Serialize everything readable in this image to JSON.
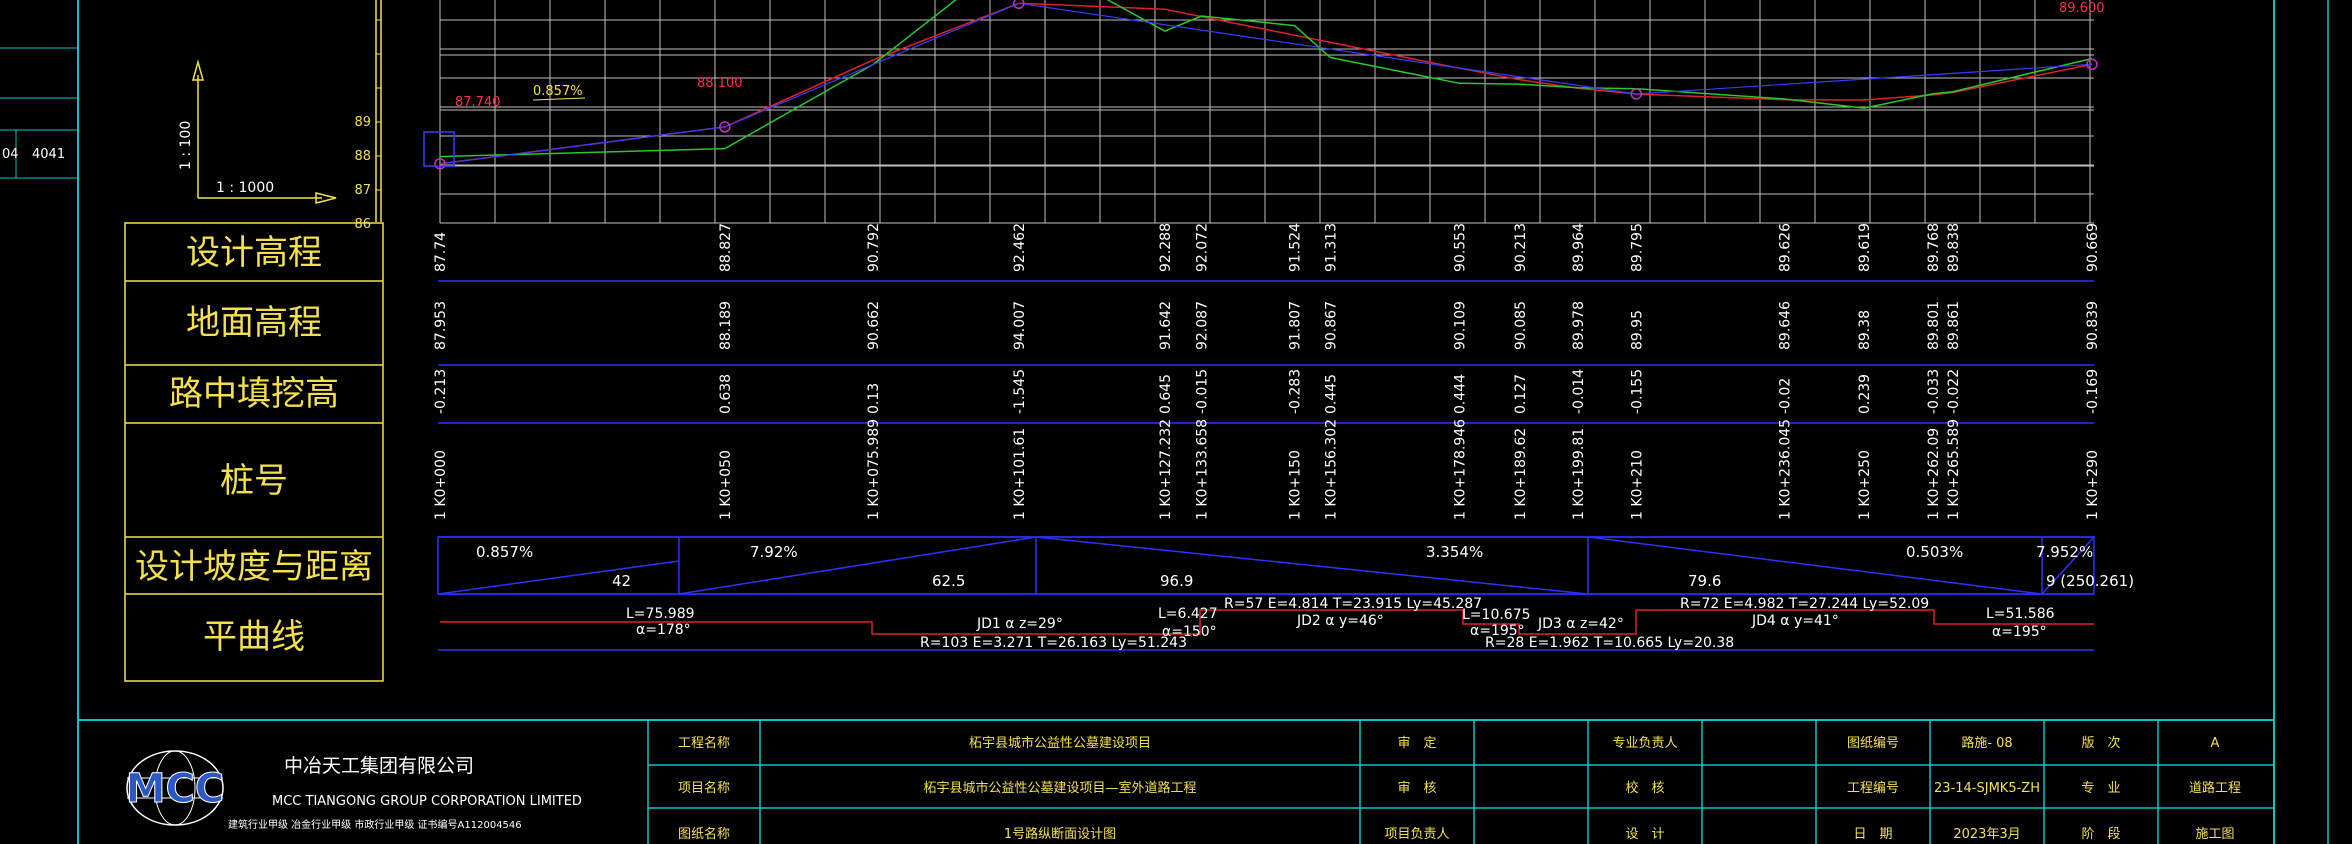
{
  "colors": {
    "background": "#000000",
    "frame": "#00c8c8",
    "label_text": "#f4e04d",
    "value_text": "#ffffff",
    "table_line": "#2f2fff",
    "design_line": "#e0202a",
    "ground_line": "#28c828",
    "blue_line": "#3a3aff",
    "annotation_red": "#ff2a55",
    "marker": "#c030c0",
    "grid": "#bfbfbf",
    "logo_blue": "#2a58c8"
  },
  "chart_data": {
    "type": "line",
    "title": "",
    "xlabel": "",
    "ylabel": "",
    "stations_m": [
      0,
      50,
      75.989,
      101.61,
      127.232,
      133.658,
      150,
      156.302,
      178.946,
      189.62,
      199.81,
      210,
      236.045,
      250,
      262.09,
      265.589,
      290
    ],
    "series": [
      {
        "name": "设计高程",
        "values": [
          87.74,
          88.827,
          90.792,
          92.462,
          92.288,
          92.072,
          91.524,
          91.313,
          90.553,
          90.213,
          89.964,
          89.795,
          89.626,
          89.619,
          89.768,
          89.838,
          90.669
        ]
      },
      {
        "name": "地面高程",
        "values": [
          87.953,
          88.189,
          90.662,
          94.007,
          91.642,
          92.087,
          91.807,
          90.867,
          90.109,
          90.085,
          89.978,
          89.95,
          89.646,
          89.38,
          89.801,
          89.861,
          90.839
        ]
      }
    ],
    "y_ticks": [
      "86",
      "87",
      "88",
      "89"
    ],
    "scale": {
      "horizontal": "1 : 1000",
      "vertical": "1 : 100"
    },
    "annotations": [
      "87.740",
      "0.857%",
      "88.100",
      "89.600"
    ]
  },
  "scale_labels": {
    "horizontal": "1 : 1000",
    "vertical": "1 : 100"
  },
  "row_labels": {
    "design_elev": "设计高程",
    "ground_elev": "地面高程",
    "cut_fill": "路中填挖高",
    "station": "桩号",
    "grade_distance": "设计坡度与距离",
    "horizontal_curve": "平曲线"
  },
  "table": {
    "design_elev": [
      "87.74",
      "88.827",
      "90.792",
      "92.462",
      "92.288",
      "92.072",
      "91.524",
      "91.313",
      "90.553",
      "90.213",
      "89.964",
      "89.795",
      "89.626",
      "89.619",
      "89.768",
      "89.838",
      "90.669"
    ],
    "ground_elev": [
      "87.953",
      "88.189",
      "90.662",
      "94.007",
      "91.642",
      "92.087",
      "91.807",
      "90.867",
      "90.109",
      "90.085",
      "89.978",
      "89.95",
      "89.646",
      "89.38",
      "89.801",
      "89.861",
      "90.839"
    ],
    "cut_fill": [
      "-0.213",
      "0.638",
      "0.13",
      "-1.545",
      "0.645",
      "-0.015",
      "-0.283",
      "0.445",
      "0.444",
      "0.127",
      "-0.014",
      "-0.155",
      "-0.02",
      "0.239",
      "-0.033",
      "-0.022",
      "-0.169"
    ],
    "station": [
      "1 K0+000",
      "1 K0+050",
      "1 K0+075.989",
      "1 K0+101.61",
      "1 K0+127.232",
      "1 K0+133.658",
      "1 K0+150",
      "1 K0+156.302",
      "1 K0+178.946",
      "1 K0+189.62",
      "1 K0+199.81",
      "1 K0+210",
      "1 K0+236.045",
      "1 K0+250",
      "1 K0+262.09",
      "1 K0+265.589",
      "1 K0+290"
    ]
  },
  "grades": [
    {
      "grade": "0.857%",
      "distance": "42"
    },
    {
      "grade": "7.92%",
      "distance": "62.5"
    },
    {
      "grade": "3.354%",
      "distance": "96.9"
    },
    {
      "grade": "0.503%",
      "distance": "79.6"
    },
    {
      "grade": "7.952%",
      "distance": "9 (250.261)"
    }
  ],
  "curves": {
    "seg1_top": "L=75.989",
    "seg1_bot": "α=178°",
    "jd1_top": "JD1  α z=29°",
    "jd1_bot": "R=103  E=3.271  T=26.163  Ly=51.243",
    "seg2_top": "L=6.427",
    "seg2_bot": "α=150°",
    "jd2_top": "R=57  E=4.814  T=23.915  Ly=45.287",
    "jd2_bot": "JD2  α y=46°",
    "seg3_top": "L=10.675",
    "seg3_bot": "α=195°",
    "jd3_top": "JD3  α z=42°",
    "jd3_bot": "R=28  E=1.962  T=10.665  Ly=20.38",
    "jd4_top": "R=72  E=4.982  T=27.244  Ly=52.09",
    "jd4_bot": "JD4  α y=41°",
    "seg4_top": "L=51.586",
    "seg4_bot": "α=195°"
  },
  "company": {
    "cn": "中冶天工集团有限公司",
    "en": "MCC TIANGONG GROUP CORPORATION LIMITED",
    "cert": "建筑行业甲级   冶金行业甲级   市政行业甲级   证书编号A112004546",
    "logo": "MCC"
  },
  "title_block": {
    "project_name_label": "工程名称",
    "project_name": "柘宇县城市公益性公墓建设项目",
    "item_name_label": "项目名称",
    "item_name": "柘宇县城市公益性公墓建设项目—室外道路工程",
    "drawing_name_label": "图纸名称",
    "drawing_name": "1号路纵断面设计图",
    "review_label": "审　定",
    "check_label": "审　核",
    "pm_label": "项目负责人",
    "prof_label": "专业负责人",
    "proof_label": "校　核",
    "design_label": "设　计",
    "drawing_no_label": "图纸编号",
    "drawing_no": "路施- 08",
    "project_no_label": "工程编号",
    "project_no": "23-14-SJMK5-ZH",
    "date_label": "日　期",
    "date": "2023年3月",
    "version_label": "版　次",
    "version": "A",
    "discipline_label": "专　业",
    "discipline": "道路工程",
    "stage_label": "阶　段",
    "stage": "施工图"
  },
  "left_fragment": {
    "a": "04",
    "b": "4041"
  }
}
